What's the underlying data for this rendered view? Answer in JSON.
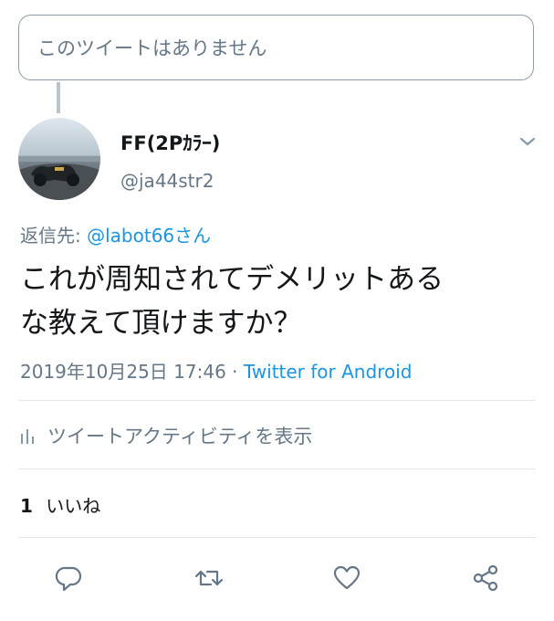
{
  "unavailable_tweet": {
    "text": "このツイートはありません"
  },
  "author": {
    "display_name": "FF(2Pｶﾗｰ)",
    "handle": "@ja44str2",
    "avatar_icon": "avatar-photo-beach"
  },
  "reply": {
    "prefix": "返信先:",
    "mention": "@labot66さん"
  },
  "tweet": {
    "line1": "これが周知されてデメリットある",
    "line2": "な教えて頂けますか？"
  },
  "meta": {
    "timestamp": "2019年10月25日 17:46",
    "separator": "·",
    "source": "Twitter for Android"
  },
  "activity": {
    "label": "ツイートアクティビティを表示",
    "icon": "bar-chart-icon"
  },
  "likes": {
    "count": "1",
    "label": "いいね"
  },
  "actions": {
    "reply_icon": "reply-icon",
    "retweet_icon": "retweet-icon",
    "like_icon": "heart-icon",
    "share_icon": "share-icon"
  },
  "colors": {
    "link": "#1b95e0",
    "secondary_text": "#657786",
    "primary_text": "#14171a",
    "divider": "#e1e8ed"
  }
}
